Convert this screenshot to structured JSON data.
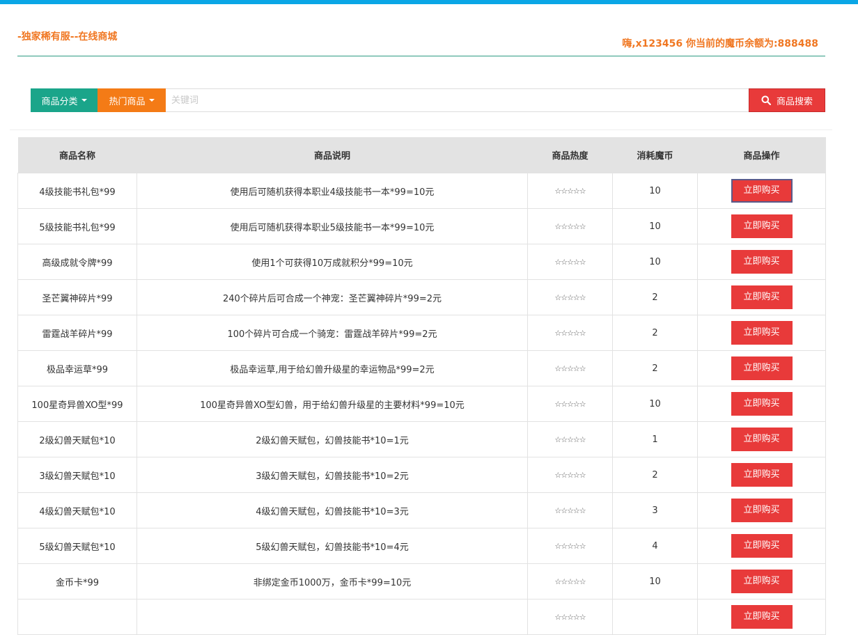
{
  "header": {
    "site_title": "-独家稀有服--在线商城",
    "balance_text": "嗨,x123456 你当前的魔币余额为:888488"
  },
  "search": {
    "category_label": "商品分类",
    "hot_label": "热门商品",
    "placeholder": "关键词",
    "search_label": "商品搜索"
  },
  "table": {
    "headers": [
      "商品名称",
      "商品说明",
      "商品热度",
      "消耗魔币",
      "商品操作"
    ],
    "buy_label": "立即购买",
    "stars": "☆☆☆☆☆",
    "rows": [
      {
        "name": "4级技能书礼包*99",
        "desc": "使用后可随机获得本职业4级技能书一本*99=10元",
        "cost": "10"
      },
      {
        "name": "5级技能书礼包*99",
        "desc": "使用后可随机获得本职业5级技能书一本*99=10元",
        "cost": "10"
      },
      {
        "name": "高级成就令牌*99",
        "desc": "使用1个可获得10万成就积分*99=10元",
        "cost": "10"
      },
      {
        "name": "圣芒翼神碎片*99",
        "desc": "240个碎片后可合成一个神宠：圣芒翼神碎片*99=2元",
        "cost": "2"
      },
      {
        "name": "雷霆战羊碎片*99",
        "desc": "100个碎片可合成一个骑宠：雷霆战羊碎片*99=2元",
        "cost": "2"
      },
      {
        "name": "极品幸运草*99",
        "desc": "极品幸运草,用于给幻兽升级星的幸运物品*99=2元",
        "cost": "2"
      },
      {
        "name": "100星奇异兽XO型*99",
        "desc": "100星奇异兽XO型幻兽，用于给幻兽升级星的主要材料*99=10元",
        "cost": "10"
      },
      {
        "name": "2级幻兽天赋包*10",
        "desc": "2级幻兽天赋包，幻兽技能书*10=1元",
        "cost": "1"
      },
      {
        "name": "3级幻兽天赋包*10",
        "desc": "3级幻兽天赋包，幻兽技能书*10=2元",
        "cost": "2"
      },
      {
        "name": "4级幻兽天赋包*10",
        "desc": "4级幻兽天赋包，幻兽技能书*10=3元",
        "cost": "3"
      },
      {
        "name": "5级幻兽天赋包*10",
        "desc": "5级幻兽天赋包，幻兽技能书*10=4元",
        "cost": "4"
      },
      {
        "name": "金币卡*99",
        "desc": "非绑定金币1000万，金币卡*99=10元",
        "cost": "10"
      },
      {
        "name": "",
        "desc": "",
        "cost": ""
      }
    ]
  }
}
